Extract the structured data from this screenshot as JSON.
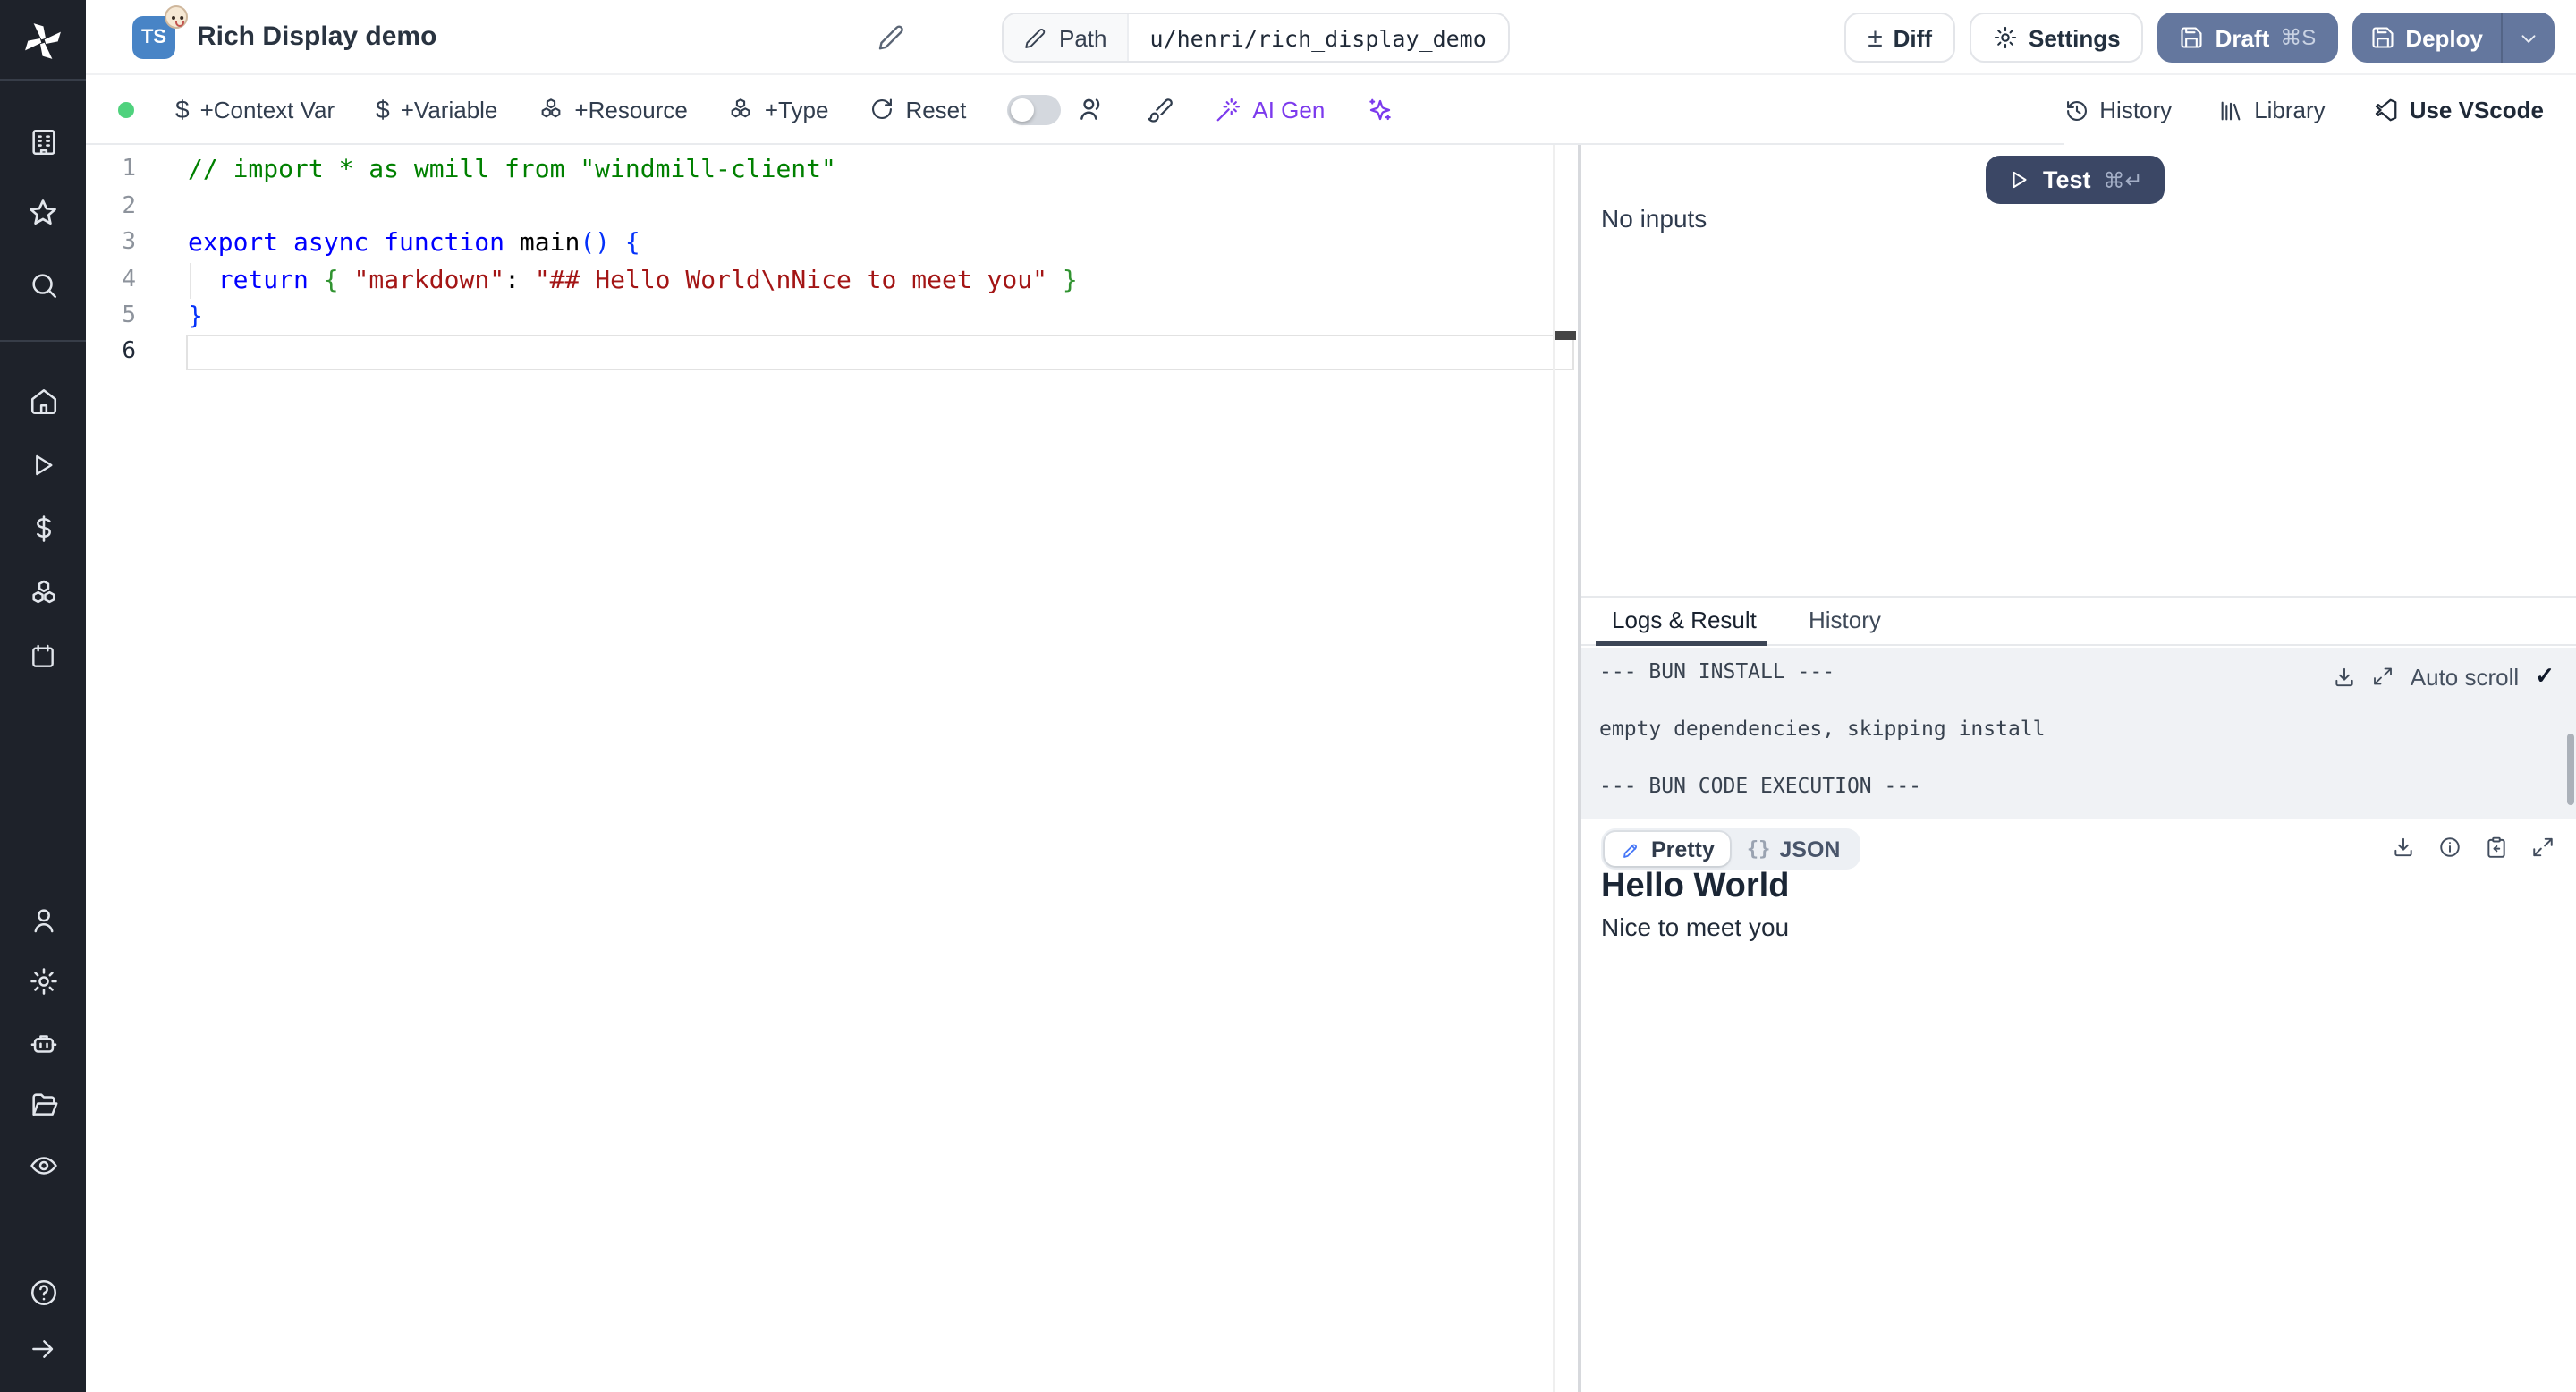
{
  "header": {
    "language_badge": "TS",
    "title": "Rich Display demo",
    "path_label": "Path",
    "path_value": "u/henri/rich_display_demo",
    "diff_glyph": "±",
    "diff_label": "Diff",
    "settings_label": "Settings",
    "draft_label": "Draft",
    "draft_shortcut": "⌘S",
    "deploy_label": "Deploy"
  },
  "toolbar": {
    "context_var_label": "+Context Var",
    "variable_label": "+Variable",
    "resource_label": "+Resource",
    "type_label": "+Type",
    "reset_label": "Reset",
    "dollar_glyph": "$",
    "ai_gen_label": "AI Gen",
    "history_label": "History",
    "library_label": "Library",
    "use_vscode_label": "Use VScode",
    "accent_purple": "#7c3aed",
    "status_dot_color": "#4fd27d"
  },
  "sidebar": {
    "icons": [
      "windmill-logo",
      "workspace-building",
      "favorites-star",
      "search",
      "home",
      "runs-play",
      "variables-dollar",
      "resources-boxes",
      "schedules-calendar",
      "user",
      "settings-gear",
      "workers-robot",
      "folders-folder",
      "audit-eye",
      "help-circle",
      "expand-arrow-right"
    ]
  },
  "editor": {
    "lines": [
      {
        "num": "1",
        "tokens": [
          {
            "t": "// import * as wmill from \"windmill-client\"",
            "c": "comment"
          }
        ]
      },
      {
        "num": "2",
        "tokens": []
      },
      {
        "num": "3",
        "tokens": [
          {
            "t": "export async function ",
            "c": "kw"
          },
          {
            "t": "main",
            "c": "fn"
          },
          {
            "t": "() {",
            "c": "b1"
          }
        ]
      },
      {
        "num": "4",
        "tokens": [
          {
            "t": "  ",
            "c": "plain"
          },
          {
            "t": "return",
            "c": "kw"
          },
          {
            "t": " ",
            "c": "plain"
          },
          {
            "t": "{",
            "c": "b2"
          },
          {
            "t": " ",
            "c": "plain"
          },
          {
            "t": "\"markdown\"",
            "c": "str"
          },
          {
            "t": ": ",
            "c": "plain"
          },
          {
            "t": "\"## Hello World\\nNice to meet you\"",
            "c": "str"
          },
          {
            "t": " ",
            "c": "plain"
          },
          {
            "t": "}",
            "c": "b2"
          }
        ]
      },
      {
        "num": "5",
        "tokens": [
          {
            "t": "}",
            "c": "b1"
          }
        ]
      },
      {
        "num": "6",
        "tokens": []
      }
    ]
  },
  "right_panel": {
    "test_label": "Test",
    "test_shortcut": "⌘↵",
    "test_button_color": "#3b4765",
    "no_inputs": "No inputs",
    "tabs": {
      "logs": "Logs & Result",
      "history": "History"
    },
    "logs": [
      "--- BUN INSTALL ---",
      "empty dependencies, skipping install",
      "--- BUN CODE EXECUTION ---"
    ],
    "auto_scroll_label": "Auto scroll",
    "auto_scroll_check": "✓",
    "result": {
      "pretty_label": "Pretty",
      "json_glyph": "{}",
      "json_label": "JSON",
      "heading": "Hello World",
      "body": "Nice to meet you"
    }
  },
  "buttons_color": "#64779e"
}
